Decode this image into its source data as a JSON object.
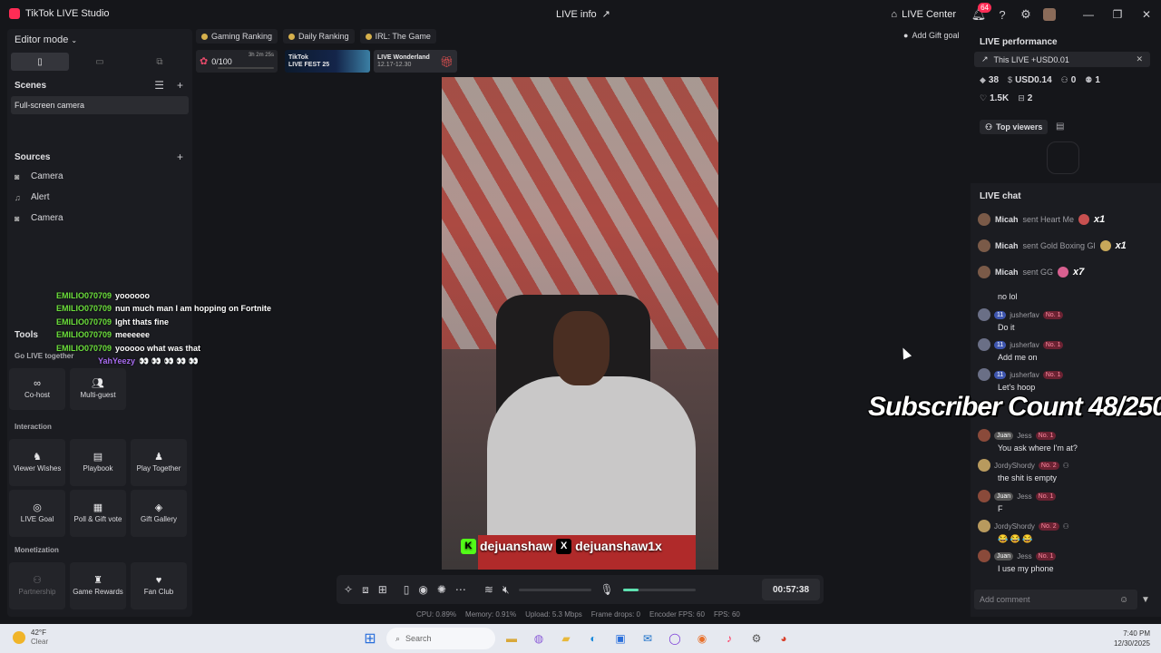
{
  "titlebar": {
    "app_name": "TikTok LIVE Studio",
    "center_title": "LIVE info",
    "live_center": "LIVE Center",
    "notif_count": "64"
  },
  "left": {
    "editor_mode": "Editor mode",
    "scenes_label": "Scenes",
    "scene_item": "Full-screen camera",
    "sources_label": "Sources",
    "sources": [
      "Camera",
      "Alert",
      "Camera"
    ],
    "tools_label": "Tools",
    "go_live_together": "Go LIVE together",
    "cohost": "Co-host",
    "multiguest": "Multi-guest",
    "interaction_label": "Interaction",
    "viewer_wishes": "Viewer Wishes",
    "playbook": "Playbook",
    "play_together": "Play Together",
    "live_goal": "LIVE Goal",
    "poll_vote": "Poll & Gift vote",
    "gift_gallery": "Gift Gallery",
    "monetization_label": "Monetization",
    "partnership": "Partnership",
    "game_rewards": "Game Rewards",
    "fan_club": "Fan Club"
  },
  "ranks": [
    "Gaming Ranking",
    "Daily Ranking",
    "IRL: The Game"
  ],
  "add_gift_goal": "Add Gift goal",
  "promos": {
    "goal": "0/100",
    "goal_time": "3h 2m 25s",
    "fest_line1": "TikTok",
    "fest_line2": "LIVE FEST 25",
    "wonder_line1": "LIVE Wonderland",
    "wonder_line2": "12.17-12.30"
  },
  "video": {
    "handle_kick": "dejuanshaw",
    "handle_x": "dejuanshaw1x"
  },
  "overlay_chat": [
    {
      "name": "EMILIO070709",
      "text": "yoooooo",
      "color": "green"
    },
    {
      "name": "EMILIO070709",
      "text": "nun much man I am hopping on Fortnite",
      "color": "green"
    },
    {
      "name": "EMILIO070709",
      "text": "lght thats fine",
      "color": "green"
    },
    {
      "name": "EMILIO070709",
      "text": "meeeeee",
      "color": "green"
    },
    {
      "name": "EMILIO070709",
      "text": "yooooo what was that",
      "color": "green"
    },
    {
      "name": "YahYeezy",
      "text": "👀 👀 👀 👀 👀",
      "color": "purple"
    }
  ],
  "subscriber_overlay": "Subscriber Count 48/250",
  "right": {
    "live_performance": "LIVE performance",
    "this_live": "This LIVE +USD0.01",
    "stats_row1": [
      "38",
      "USD0.14",
      "0",
      "1"
    ],
    "stats_row2": [
      "1.5K",
      "2"
    ],
    "top_viewers": "Top viewers",
    "live_chat": "LIVE chat",
    "gifts": [
      {
        "name": "Micah",
        "action": "sent Heart Me",
        "mult": "x1"
      },
      {
        "name": "Micah",
        "action": "sent Gold Boxing Gl",
        "mult": "x1"
      },
      {
        "name": "Micah",
        "action": "sent GG",
        "mult": "x7"
      }
    ],
    "partial_msg": "no lol",
    "messages": [
      {
        "user": "jusherfav",
        "level": "11",
        "rank": "No. 1",
        "text": "Do it"
      },
      {
        "user": "jusherfav",
        "level": "11",
        "rank": "No. 1",
        "text": "Add me on"
      },
      {
        "user": "jusherfav",
        "level": "11",
        "rank": "No. 1",
        "text": "Let's hoop"
      },
      {
        "user": "Jess",
        "level": "Juan",
        "rank": "No. 1",
        "text": "You ask where I'm at?"
      },
      {
        "user": "JordyShordy",
        "level": "",
        "rank": "No. 2",
        "text": "the shit is empty"
      },
      {
        "user": "Jess",
        "level": "Juan",
        "rank": "No. 1",
        "text": "F"
      },
      {
        "user": "JordyShordy",
        "level": "",
        "rank": "No. 2",
        "text": "😂 😂 😂"
      },
      {
        "user": "Jess",
        "level": "Juan",
        "rank": "No. 1",
        "text": "I use my phone"
      }
    ],
    "add_comment": "Add comment"
  },
  "controls": {
    "timer": "00:57:38",
    "mic_level": 0.22
  },
  "status": {
    "cpu": "CPU:  0.89%",
    "memory": "Memory:  0.91%",
    "upload": "Upload:  5.3 Mbps",
    "frame_drops": "Frame drops:  0",
    "encoder_fps": "Encoder FPS:  60",
    "fps": "FPS:  60"
  },
  "taskbar": {
    "temp": "42°F",
    "weather": "Clear",
    "search": "Search",
    "time": "7:40 PM",
    "date": "12/30/2025"
  }
}
